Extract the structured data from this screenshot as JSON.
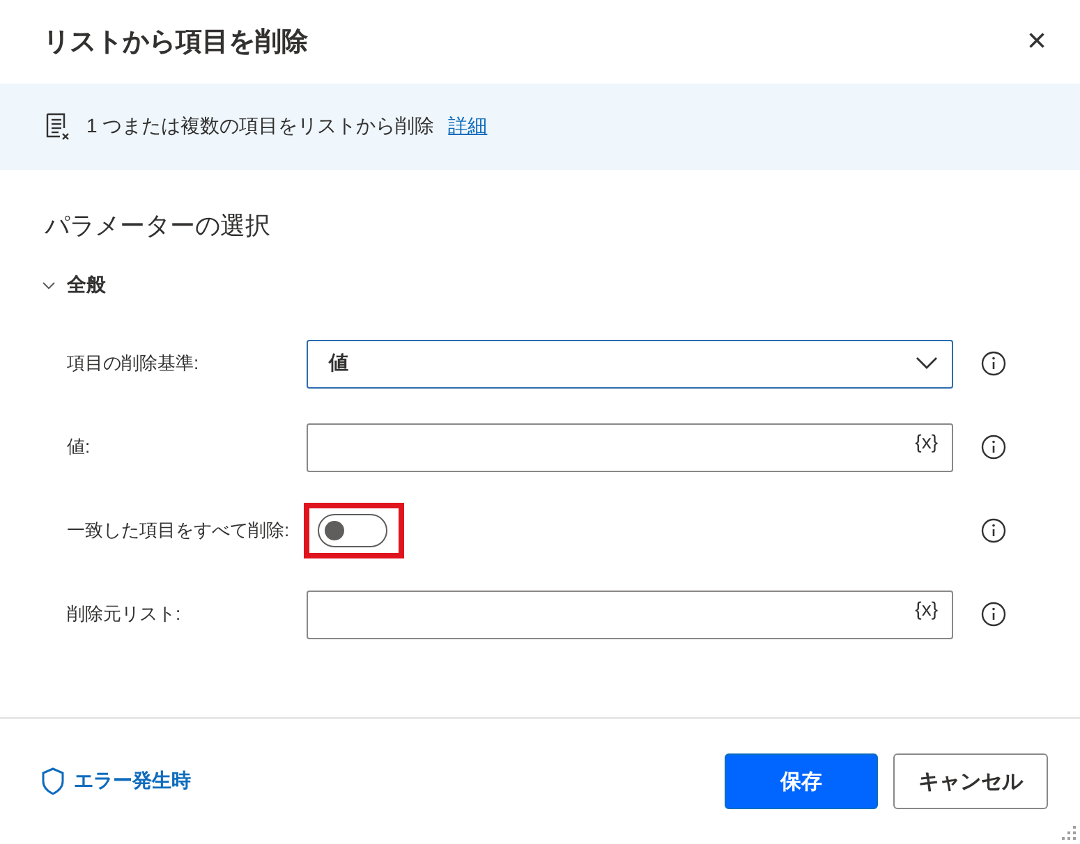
{
  "window": {
    "title": "リストから項目を削除",
    "close": "×"
  },
  "banner": {
    "text": "1 つまたは複数の項目をリストから削除",
    "link": "詳細"
  },
  "section_title": "パラメーターの選択",
  "group": {
    "label": "全般",
    "expanded": true
  },
  "fields": [
    {
      "kind": "dropdown",
      "label": "項目の削除基準:",
      "value": "値",
      "focused": true
    },
    {
      "kind": "text",
      "label": "値:",
      "variable_button": "{x}"
    },
    {
      "kind": "toggle",
      "label": "一致した項目をすべて削除:",
      "on": false,
      "highlighted": true
    },
    {
      "kind": "text",
      "label": "削除元リスト:",
      "variable_button": "{x}"
    }
  ],
  "footer": {
    "error_link": "エラー発生時",
    "buttons": [
      {
        "label": "保存",
        "kind": "primary"
      },
      {
        "label": "キャンセル",
        "kind": "secondary"
      }
    ]
  }
}
